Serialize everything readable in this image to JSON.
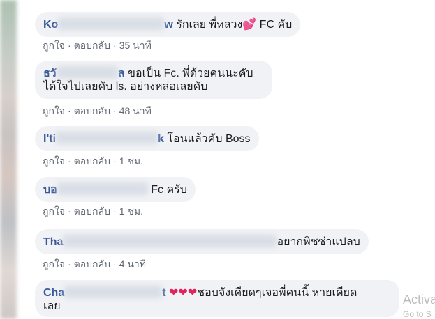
{
  "comments": [
    {
      "author_start": "Ko",
      "author_end": "w",
      "text": "รักเลย พี่หลวง💕 FC คับ",
      "like": "ถูกใจ",
      "reply": "ตอบกลับ",
      "time": "35 นาที"
    },
    {
      "author_start": "ธวั",
      "author_end": "ล",
      "text_line1": "ขอเป็น Fc. พี่ด้วยคนนะคับ",
      "text_line2": "ได้ใจไปเลยคับ ls. อย่างหล่อเลยคับ",
      "like": "ถูกใจ",
      "reply": "ตอบกลับ",
      "time": "48 นาที"
    },
    {
      "author_start": "I'ti",
      "author_end": "k",
      "text": "โอนแล้วคับ Boss",
      "like": "ถูกใจ",
      "reply": "ตอบกลับ",
      "time": "1 ชม."
    },
    {
      "author_start": "บอ",
      "author_end": "",
      "text": "Fc ครับ",
      "like": "ถูกใจ",
      "reply": "ตอบกลับ",
      "time": "1 ชม."
    },
    {
      "author_start": "Tha",
      "author_end": "",
      "text": "อยากพิซซ่าแปลบ",
      "like": "ถูกใจ",
      "reply": "ตอบกลับ",
      "time": "4 นาที"
    },
    {
      "author_start": "Cha",
      "author_end": "t",
      "hearts": "❤❤❤",
      "text_line1": "ชอบจังเคียดๆเจอพี่คนนี้ หายเคียด",
      "text_line2": "เลย"
    }
  ],
  "watermark": {
    "line1": "Activa",
    "line2": "Go to S"
  },
  "separator": "·",
  "colors": {
    "bubble": "#f0f2f5",
    "author": "#385898",
    "meta": "#606770",
    "heart": "#e0245e"
  }
}
